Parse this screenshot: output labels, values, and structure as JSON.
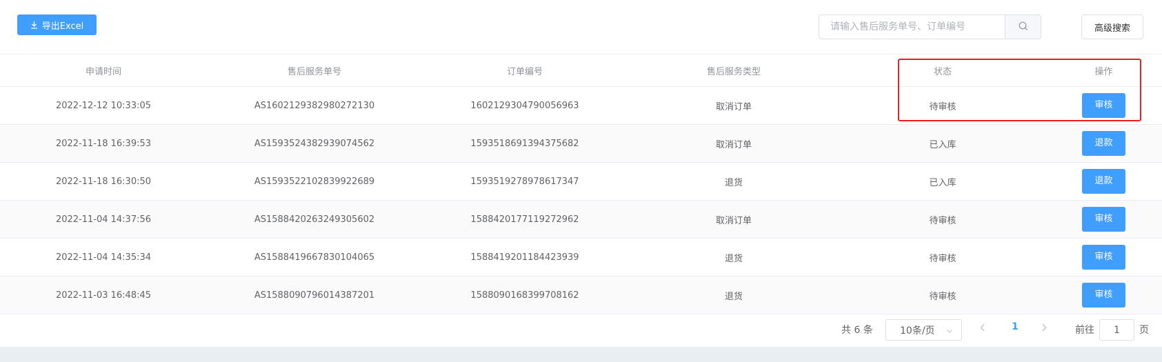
{
  "toolbar": {
    "export_label": "导出Excel",
    "search_placeholder": "请输入售后服务单号、订单编号",
    "search_value": "",
    "advanced_label": "高级搜索"
  },
  "table": {
    "headers": [
      "申请时间",
      "售后服务单号",
      "订单编号",
      "售后服务类型",
      "状态",
      "操作"
    ],
    "rows": [
      {
        "time": "2022-12-12 10:33:05",
        "service_no": "AS1602129382980272130",
        "order_no": "1602129304790056963",
        "type": "取消订单",
        "status": "待审核",
        "action": "审核"
      },
      {
        "time": "2022-11-18 16:39:53",
        "service_no": "AS1593524382939074562",
        "order_no": "1593518691394375682",
        "type": "取消订单",
        "status": "已入库",
        "action": "退款"
      },
      {
        "time": "2022-11-18 16:30:50",
        "service_no": "AS1593522102839922689",
        "order_no": "1593519278978617347",
        "type": "退货",
        "status": "已入库",
        "action": "退款"
      },
      {
        "time": "2022-11-04 14:37:56",
        "service_no": "AS1588420263249305602",
        "order_no": "1588420177119272962",
        "type": "取消订单",
        "status": "待审核",
        "action": "审核"
      },
      {
        "time": "2022-11-04 14:35:34",
        "service_no": "AS1588419667830104065",
        "order_no": "1588419201184423939",
        "type": "退货",
        "status": "待审核",
        "action": "审核"
      },
      {
        "time": "2022-11-03 16:48:45",
        "service_no": "AS1588090796014387201",
        "order_no": "1588090168399708162",
        "type": "退货",
        "status": "待审核",
        "action": "审核"
      }
    ]
  },
  "pagination": {
    "total_text": "共 6 条",
    "page_size": "10条/页",
    "current_page": "1",
    "goto_label": "前往",
    "goto_value": "1",
    "goto_suffix": "页"
  },
  "colors": {
    "primary": "#409eff",
    "highlight": "#ee1c1c"
  },
  "icons": [
    "download-icon",
    "search-icon",
    "chevron-down-icon",
    "chevron-left-icon",
    "chevron-right-icon"
  ]
}
